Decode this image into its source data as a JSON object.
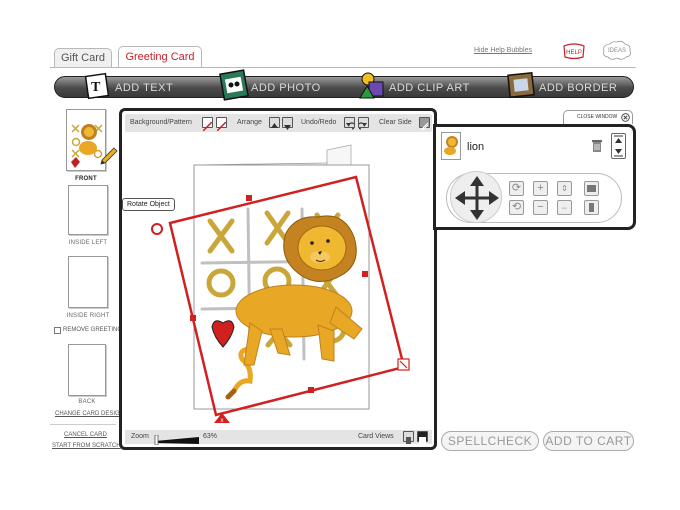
{
  "tabs": [
    {
      "label": "Gift Card",
      "active": false
    },
    {
      "label": "Greeting Card",
      "active": true
    }
  ],
  "help": {
    "hide_label": "Hide Help Bubbles",
    "help_badge": "HELP",
    "ideas_badge": "IDEAS"
  },
  "toolbar": {
    "add_text": "ADD TEXT",
    "add_photo": "ADD PHOTO",
    "add_clip_art": "ADD CLIP ART",
    "add_border": "ADD BORDER"
  },
  "sides": [
    {
      "label": "FRONT",
      "selected": true
    },
    {
      "label": "INSIDE LEFT",
      "selected": false
    },
    {
      "label": "INSIDE RIGHT",
      "selected": false
    },
    {
      "label": "BACK",
      "selected": false
    }
  ],
  "remove_greeting": "REMOVE GREETING",
  "change_card_design": "CHANGE CARD DESIGN",
  "cancel_card": "CANCEL CARD",
  "start_from_scratch": "START FROM SCRATCH",
  "editor": {
    "background_label": "Background/Pattern",
    "arrange_label": "Arrange",
    "undo_label": "Undo/Redo",
    "clear_label": "Clear Side",
    "zoom_label": "Zoom",
    "zoom_value": "63%",
    "zoom_level": 0.63,
    "card_views_label": "Card Views",
    "rotate_tooltip": "Rotate Object"
  },
  "object_panel": {
    "close_label": "CLOSE WINDOW",
    "object_name": "lion"
  },
  "buttons": {
    "spellcheck": "SPELLCHECK",
    "add_to_cart": "ADD TO CART"
  },
  "colors": {
    "accent": "#c8202a",
    "selection": "#d02020",
    "toolbar_dark": "#3a3a3a",
    "lion": "#e8a825",
    "xo": "#c9a63a"
  }
}
